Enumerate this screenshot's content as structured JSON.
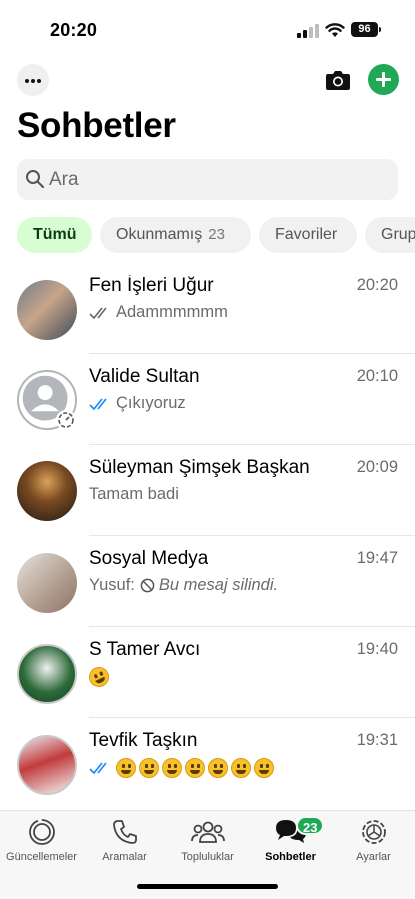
{
  "status_bar": {
    "time": "20:20",
    "battery": "96"
  },
  "header": {
    "title": "Sohbetler",
    "icons": [
      "more-icon",
      "camera-icon",
      "plus-icon"
    ]
  },
  "search": {
    "placeholder": "Ara"
  },
  "filters": {
    "all": "Tümü",
    "unread": "Okunmamış",
    "unread_count": "23",
    "favorites": "Favoriler",
    "groups": "Gruplar"
  },
  "chats": [
    {
      "name": "Fen İşleri Uğur",
      "time": "20:20",
      "preview": "Adammmmmm",
      "ticks": "delivered"
    },
    {
      "name": "Valide Sultan",
      "time": "20:10",
      "preview": "Çıkıyoruz",
      "ticks": "read"
    },
    {
      "name": "Süleyman Şimşek Başkan",
      "time": "20:09",
      "preview": "Tamam badi"
    },
    {
      "name": "Sosyal Medya",
      "time": "19:47",
      "sender": "Yusuf:",
      "preview": "Bu mesaj silindi."
    },
    {
      "name": "S Tamer Avcı",
      "time": "19:40",
      "preview_emoji": "rofl"
    },
    {
      "name": "Tevfik Taşkın",
      "time": "19:31",
      "ticks": "read",
      "preview_emoji": "grinning x7"
    }
  ],
  "tab_bar": {
    "tabs": [
      {
        "label": "Güncellemeler",
        "icon": "updates-icon"
      },
      {
        "label": "Aramalar",
        "icon": "phone-icon"
      },
      {
        "label": "Topluluklar",
        "icon": "communities-icon"
      },
      {
        "label": "Sohbetler",
        "icon": "chats-icon",
        "badge": "23"
      },
      {
        "label": "Ayarlar",
        "icon": "settings-icon"
      }
    ]
  },
  "colors": {
    "accent_green": "#1fa855",
    "active_chip_bg": "#d8fdd2",
    "read_ticks": "#1d8cf8"
  }
}
